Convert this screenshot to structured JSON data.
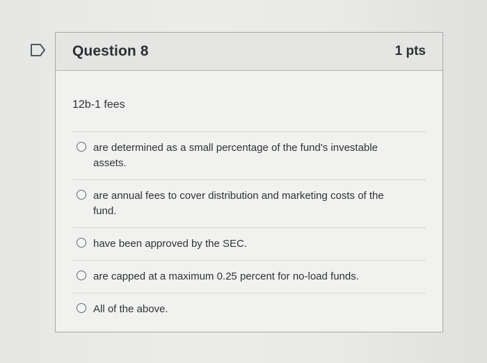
{
  "question": {
    "title": "Question 8",
    "points": "1 pts",
    "text": "12b-1 fees",
    "bookmark_icon": "bookmark-flag-icon"
  },
  "answers": [
    {
      "label": "are determined as a small percentage of the fund's investable assets."
    },
    {
      "label": "are annual fees to cover distribution and marketing costs of the fund."
    },
    {
      "label": "have been approved by the SEC."
    },
    {
      "label": "are capped at a maximum 0.25 percent for no-load funds."
    },
    {
      "label": "All of the above."
    }
  ],
  "colors": {
    "border": "#a7a9a8",
    "header_bg": "#e5e6e4",
    "text": "#2d3337"
  }
}
